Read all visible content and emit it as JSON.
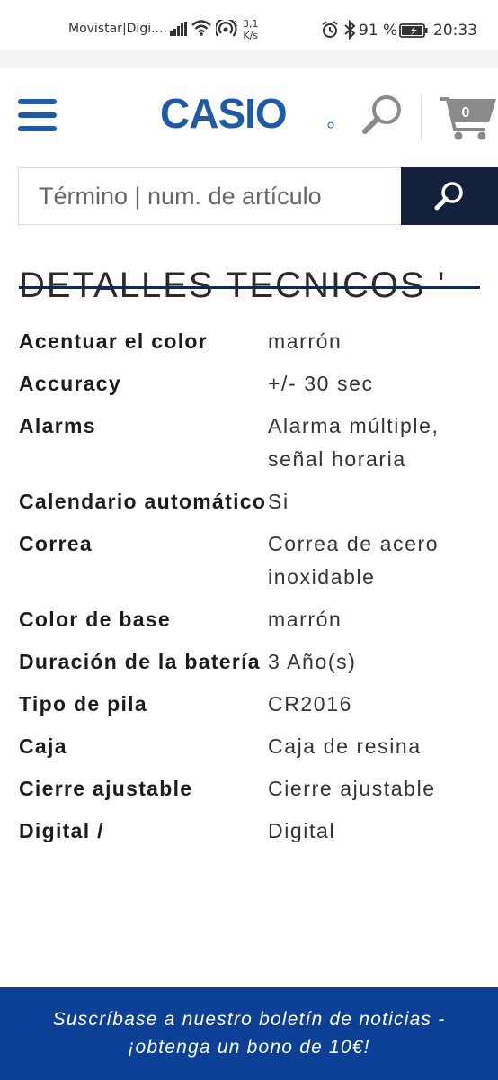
{
  "status_bar": {
    "carrier": "Movistar|Digi....",
    "speed_top": "3,1",
    "speed_bottom": "K/s",
    "battery": "91 %",
    "time": "20:33"
  },
  "header": {
    "menu_icon": "hamburger-menu-icon",
    "logo_text": "CASIO",
    "search_icon": "search-icon",
    "cart_icon": "shopping-cart-icon",
    "cart_count": "0"
  },
  "search": {
    "placeholder": "Término | num. de artículo",
    "submit_icon": "search-icon"
  },
  "section": {
    "title": "DETALLES TECNICOS '"
  },
  "specs": [
    {
      "label": "Acentuar el color",
      "value": "marrón"
    },
    {
      "label": "Accuracy",
      "value": "+/- 30 sec"
    },
    {
      "label": "Alarms",
      "value": "Alarma múltiple, señal horaria"
    },
    {
      "label": "Calendario automático",
      "value": "Si"
    },
    {
      "label": "Correa",
      "value": "Correa de acero inoxidable"
    },
    {
      "label": "Color de base",
      "value": "marrón"
    },
    {
      "label": "Duración de la batería",
      "value": "3 Año(s)"
    },
    {
      "label": "Tipo de pila",
      "value": "CR2016"
    },
    {
      "label": "Caja",
      "value": "Caja de resina"
    },
    {
      "label": "Cierre ajustable",
      "value": "Cierre ajustable"
    },
    {
      "label": "Digital /",
      "value": "Digital"
    }
  ],
  "newsletter": {
    "line1": "Suscríbase a nuestro boletín de noticias -",
    "line2": "¡obtenga un bono de 10€!"
  },
  "colors": {
    "brand_blue": "#1e5aa8",
    "dark_navy": "#13213c",
    "banner_blue": "#0c3f96",
    "cart_grey": "#8a8a8a"
  }
}
